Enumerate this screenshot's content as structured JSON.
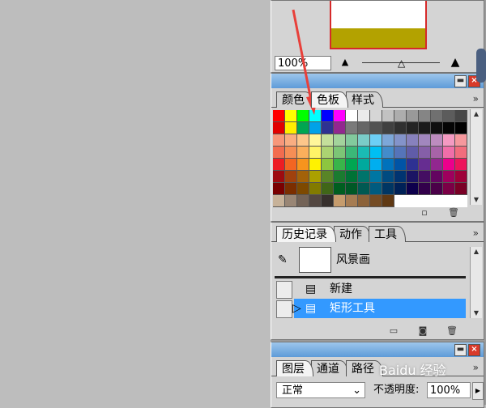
{
  "navigator": {
    "zoom_value": "100%",
    "zoom_out_icon": "mountain-small-icon",
    "zoom_in_icon": "mountain-large-icon"
  },
  "swatch_panel": {
    "tabs": [
      "颜色",
      "色板",
      "样式"
    ],
    "active_tab": "色板",
    "menu_glyph": "»",
    "swatches": [
      [
        "#ff0000",
        "#ffff00",
        "#00ff00",
        "#00ffff",
        "#0000ff",
        "#ff00ff",
        "#ffffff",
        "#ebebeb",
        "#d6d6d6",
        "#c2c2c2",
        "#adadad",
        "#999999",
        "#858585",
        "#707070",
        "#5c5c5c",
        "#474747"
      ],
      [
        "#e10000",
        "#ffee00",
        "#00a651",
        "#00a2e8",
        "#2e3192",
        "#92278f",
        "#7a7a7a",
        "#666666",
        "#525252",
        "#404040",
        "#303030",
        "#242424",
        "#1a1a1a",
        "#0f0f0f",
        "#050505",
        "#000000"
      ],
      [
        "#f7977a",
        "#f9ad81",
        "#fdc68a",
        "#fff79a",
        "#c4df9b",
        "#a3d39c",
        "#82ca9d",
        "#7accc8",
        "#6dcff6",
        "#7da7d9",
        "#8393ca",
        "#8781bd",
        "#a187be",
        "#bd8cbf",
        "#f49ac2",
        "#f6989d"
      ],
      [
        "#f26c4f",
        "#f68e55",
        "#fbaf5c",
        "#fff467",
        "#acd372",
        "#7cc576",
        "#3bb878",
        "#1abbb4",
        "#00bff3",
        "#438ccb",
        "#5574b9",
        "#605ca8",
        "#855fa8",
        "#a763a8",
        "#f06ea9",
        "#f26d7d"
      ],
      [
        "#ed1c24",
        "#f26522",
        "#f7941d",
        "#fff200",
        "#8dc63f",
        "#39b54a",
        "#00a651",
        "#00a99d",
        "#00aeef",
        "#0072bc",
        "#0054a6",
        "#2e3192",
        "#662d91",
        "#92278f",
        "#ec008c",
        "#ed145b"
      ],
      [
        "#9e0b0f",
        "#a0410d",
        "#a36209",
        "#aba000",
        "#598527",
        "#1a7b30",
        "#007236",
        "#00746b",
        "#0076a3",
        "#004b80",
        "#003471",
        "#1b1464",
        "#440e62",
        "#630460",
        "#9e005d",
        "#9e0039"
      ],
      [
        "#790000",
        "#7b2e00",
        "#7d4900",
        "#827b00",
        "#406618",
        "#005e20",
        "#005826",
        "#005952",
        "#005b7f",
        "#003663",
        "#002157",
        "#0d004c",
        "#32004b",
        "#4b0049",
        "#7b0046",
        "#7a0026"
      ],
      [
        "#c7b299",
        "#998675",
        "#736357",
        "#534741",
        "#37302d",
        "#c69c6d",
        "#a67c52",
        "#8c6239",
        "#754c24",
        "#603913",
        "",
        "",
        "",
        "",
        "",
        ""
      ]
    ]
  },
  "history_panel": {
    "tabs": [
      "历史记录",
      "动作",
      "工具"
    ],
    "active_tab": "历史记录",
    "snapshot_label": "风景画",
    "snapshot_icon": "brush-icon",
    "steps": [
      {
        "label": "新建",
        "selected": false
      },
      {
        "label": "矩形工具",
        "selected": true
      }
    ]
  },
  "layers_panel": {
    "tabs": [
      "图层",
      "通道",
      "路径"
    ],
    "active_tab": "图层",
    "blend_mode": "正常",
    "opacity_label": "不透明度:",
    "opacity_value": "100%"
  },
  "watermark": "Baidu 经验"
}
